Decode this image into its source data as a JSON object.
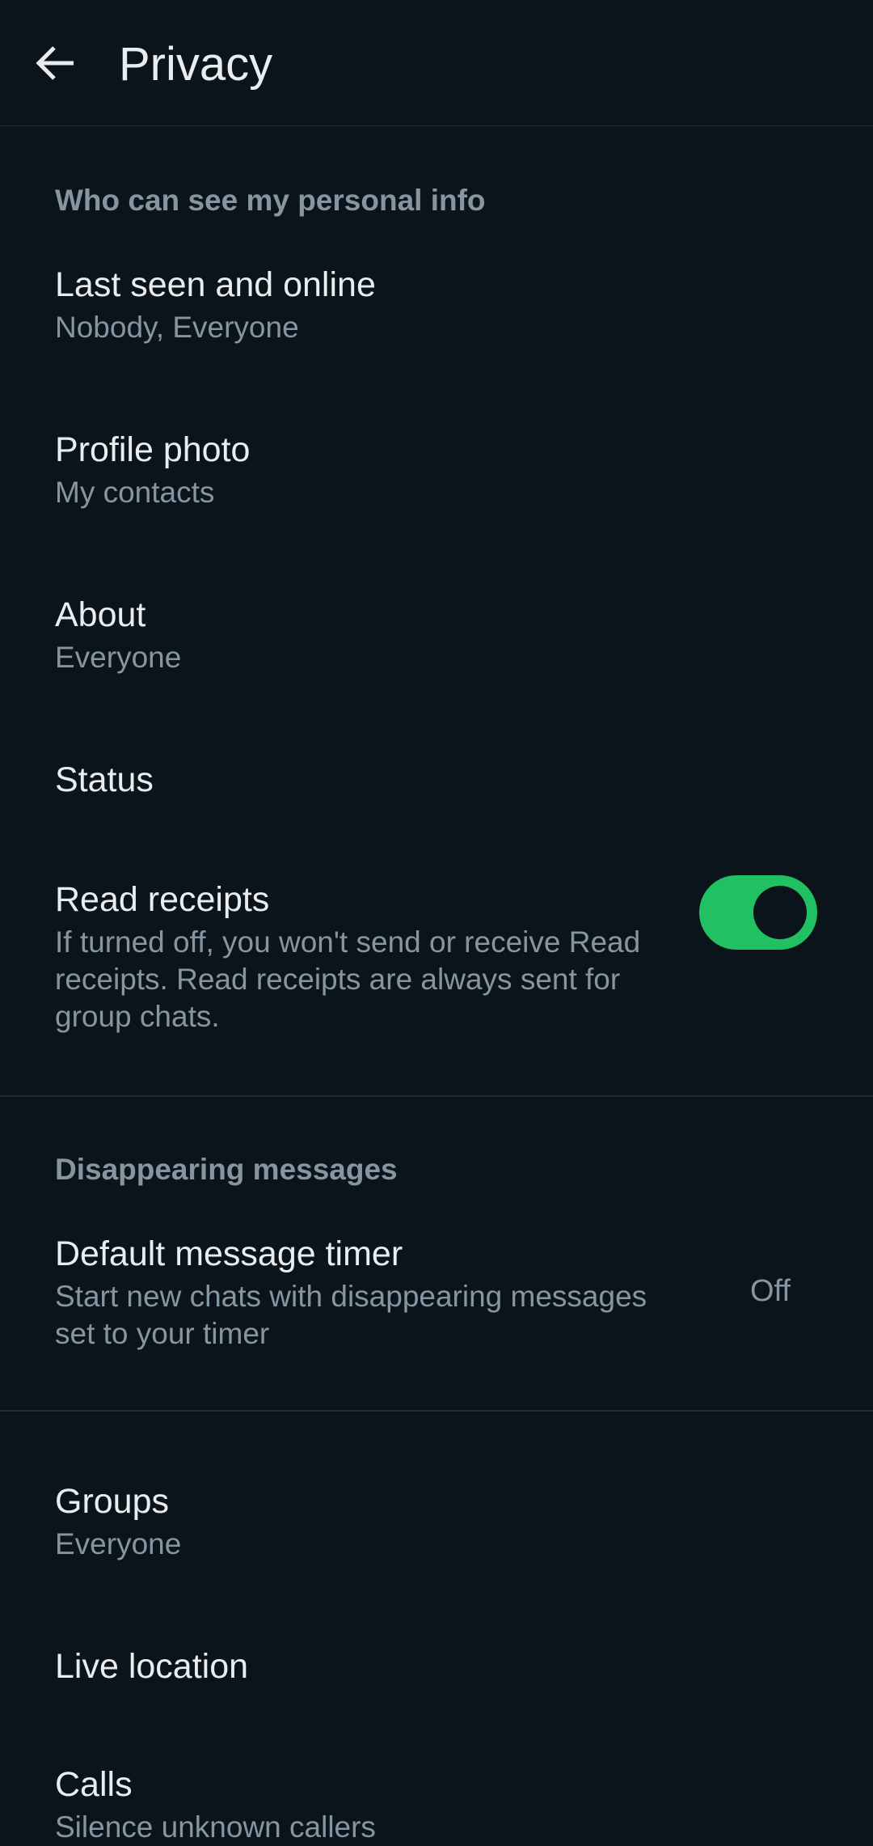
{
  "header": {
    "title": "Privacy",
    "back_icon": "arrow-left-icon"
  },
  "colors": {
    "background": "#0b141a",
    "primary_text": "#e9edef",
    "secondary_text": "#8696a0",
    "divider": "#1f2b32",
    "accent_green": "#21c063"
  },
  "section_personal": {
    "header": "Who can see my personal info",
    "items": [
      {
        "title": "Last seen and online",
        "subtitle": "Nobody, Everyone"
      },
      {
        "title": "Profile photo",
        "subtitle": "My contacts"
      },
      {
        "title": "About",
        "subtitle": "Everyone"
      },
      {
        "title": "Status"
      }
    ],
    "read_receipts": {
      "title": "Read receipts",
      "line1": "If turned off, you won't send or receive Read",
      "line2": "receipts. Read receipts are always sent for",
      "line3": "group chats.",
      "enabled": true
    }
  },
  "section_disappearing": {
    "header": "Disappearing messages",
    "timer": {
      "title": "Default message timer",
      "line1": "Start new chats with disappearing messages",
      "line2": "set to your timer",
      "value": "Off"
    }
  },
  "section_more": {
    "items": [
      {
        "title": "Groups",
        "subtitle": "Everyone"
      },
      {
        "title": "Live location"
      },
      {
        "title": "Calls",
        "subtitle": "Silence unknown callers"
      }
    ]
  }
}
